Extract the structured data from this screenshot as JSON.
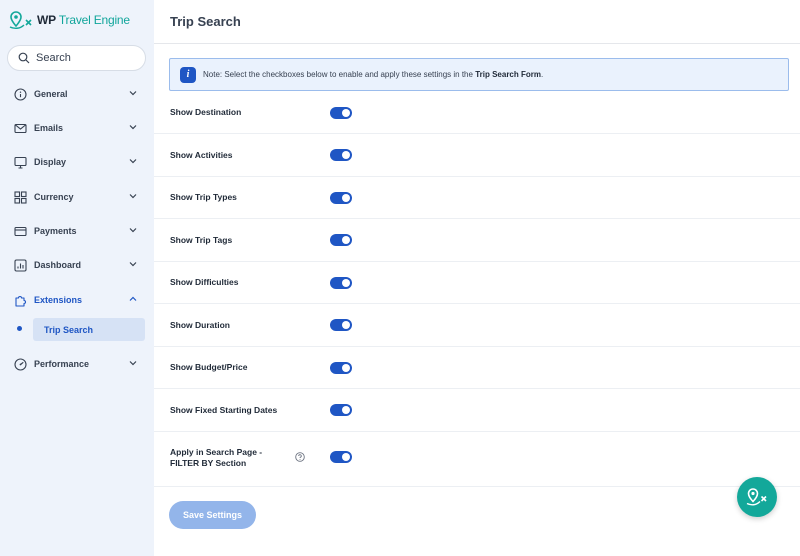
{
  "brand": {
    "prefix": "WP",
    "name": "Travel Engine"
  },
  "search": {
    "placeholder": "Search"
  },
  "sidebar": {
    "items": [
      {
        "label": "General",
        "icon": "info-icon"
      },
      {
        "label": "Emails",
        "icon": "mail-icon"
      },
      {
        "label": "Display",
        "icon": "display-icon"
      },
      {
        "label": "Currency",
        "icon": "currency-icon"
      },
      {
        "label": "Payments",
        "icon": "card-icon"
      },
      {
        "label": "Dashboard",
        "icon": "dashboard-icon"
      },
      {
        "label": "Extensions",
        "icon": "extensions-icon",
        "expanded": true
      },
      {
        "label": "Performance",
        "icon": "performance-icon"
      }
    ],
    "sub_item": "Trip Search"
  },
  "page": {
    "title": "Trip Search",
    "note_prefix": "Note: Select the checkboxes below to enable and apply these settings in the ",
    "note_bold": "Trip Search Form",
    "note_suffix": "."
  },
  "settings": [
    {
      "label": "Show Destination",
      "enabled": true
    },
    {
      "label": "Show Activities",
      "enabled": true
    },
    {
      "label": "Show Trip Types",
      "enabled": true
    },
    {
      "label": "Show Trip Tags",
      "enabled": true
    },
    {
      "label": "Show Difficulties",
      "enabled": true
    },
    {
      "label": "Show Duration",
      "enabled": true
    },
    {
      "label": "Show Budget/Price",
      "enabled": true
    },
    {
      "label": "Show Fixed Starting Dates",
      "enabled": true
    }
  ],
  "filter_setting": {
    "label_line1": "Apply in Search Page -",
    "label_line2": "FILTER BY Section",
    "enabled": true
  },
  "save_label": "Save Settings",
  "colors": {
    "accent": "#1f56c4",
    "brand": "#13a89a",
    "sidebar_bg": "#eef3fb"
  }
}
